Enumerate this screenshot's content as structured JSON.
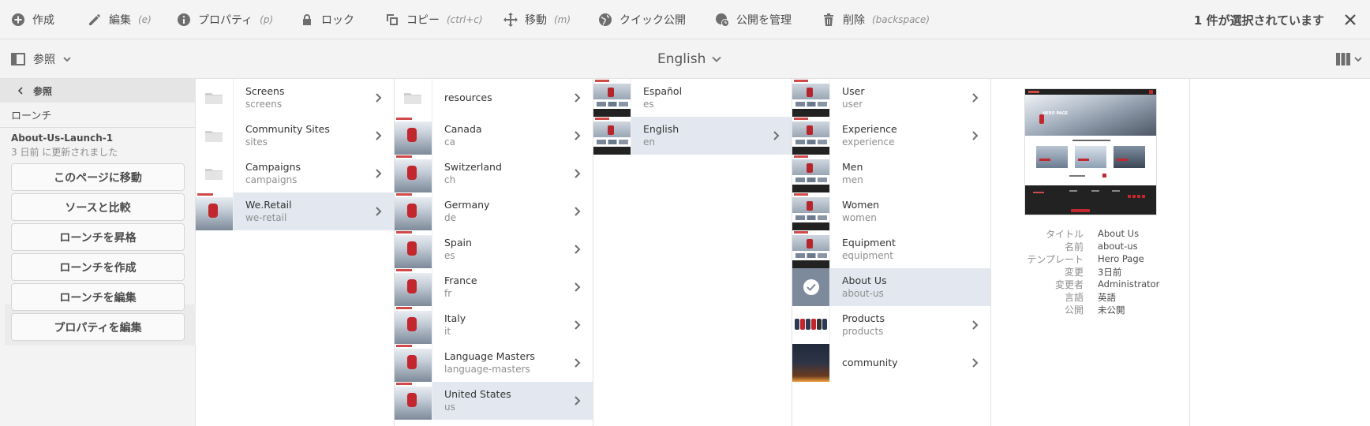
{
  "toolbar": {
    "items": [
      {
        "label": "作成",
        "key": "",
        "icon": "plus-circle-icon"
      },
      {
        "label": "編集",
        "key": "(e)",
        "icon": "pencil-icon"
      },
      {
        "label": "プロパティ",
        "key": "(p)",
        "icon": "info-icon"
      },
      {
        "label": "ロック",
        "key": "",
        "icon": "lock-icon"
      },
      {
        "label": "コピー",
        "key": "(ctrl+c)",
        "icon": "copy-icon"
      },
      {
        "label": "移動",
        "key": "(m)",
        "icon": "move-icon"
      },
      {
        "label": "クイック公開",
        "key": "",
        "icon": "globe-icon"
      },
      {
        "label": "公開を管理",
        "key": "",
        "icon": "globe-clock-icon"
      },
      {
        "label": "削除",
        "key": "(backspace)",
        "icon": "trash-icon"
      }
    ],
    "selection_count": "1 件が選択されています"
  },
  "header": {
    "rail_label": "参照",
    "language": "English"
  },
  "rail": {
    "back_label": "参照",
    "section": "ローンチ",
    "launch_title": "About-Us-Launch-1",
    "launch_updated": "3 日前 に更新されました",
    "buttons": [
      "このページに移動",
      "ソースと比較",
      "ローンチを昇格",
      "ローンチを作成",
      "ローンチを編集",
      "プロパティを編集"
    ]
  },
  "columns": [
    {
      "items": [
        {
          "title": "Screens",
          "name": "screens",
          "thumb": "folder",
          "chevron": true
        },
        {
          "title": "Community Sites",
          "name": "sites",
          "thumb": "folder",
          "chevron": true
        },
        {
          "title": "Campaigns",
          "name": "campaigns",
          "thumb": "folder",
          "chevron": true
        },
        {
          "title": "We.Retail",
          "name": "we-retail",
          "thumb": "red",
          "chevron": true,
          "selected": true
        }
      ]
    },
    {
      "items": [
        {
          "title": "resources",
          "name": "",
          "thumb": "folder",
          "chevron": true
        },
        {
          "title": "Canada",
          "name": "ca",
          "thumb": "red",
          "chevron": true
        },
        {
          "title": "Switzerland",
          "name": "ch",
          "thumb": "red",
          "chevron": true
        },
        {
          "title": "Germany",
          "name": "de",
          "thumb": "red",
          "chevron": true
        },
        {
          "title": "Spain",
          "name": "es",
          "thumb": "red",
          "chevron": true
        },
        {
          "title": "France",
          "name": "fr",
          "thumb": "red",
          "chevron": true
        },
        {
          "title": "Italy",
          "name": "it",
          "thumb": "red",
          "chevron": true
        },
        {
          "title": "Language Masters",
          "name": "language-masters",
          "thumb": "red",
          "chevron": true
        },
        {
          "title": "United States",
          "name": "us",
          "thumb": "red",
          "chevron": true,
          "selected": true
        }
      ]
    },
    {
      "items": [
        {
          "title": "Español",
          "name": "es",
          "thumb": "page",
          "chevron": false
        },
        {
          "title": "English",
          "name": "en",
          "thumb": "page",
          "chevron": true,
          "selected": true
        }
      ]
    },
    {
      "items": [
        {
          "title": "User",
          "name": "user",
          "thumb": "page",
          "chevron": true
        },
        {
          "title": "Experience",
          "name": "experience",
          "thumb": "page",
          "chevron": true
        },
        {
          "title": "Men",
          "name": "men",
          "thumb": "page",
          "chevron": false
        },
        {
          "title": "Women",
          "name": "women",
          "thumb": "page",
          "chevron": false
        },
        {
          "title": "Equipment",
          "name": "equipment",
          "thumb": "page",
          "chevron": false
        },
        {
          "title": "About Us",
          "name": "about-us",
          "thumb": "check",
          "chevron": false,
          "selected": true
        },
        {
          "title": "Products",
          "name": "products",
          "thumb": "products",
          "chevron": true
        },
        {
          "title": "community",
          "name": "",
          "thumb": "night",
          "chevron": true
        }
      ]
    }
  ],
  "preview": {
    "hero_text": "HERO PAGE",
    "meta": [
      {
        "label": "タイトル",
        "value": "About Us"
      },
      {
        "label": "名前",
        "value": "about-us"
      },
      {
        "label": "テンプレート",
        "value": "Hero Page"
      },
      {
        "label": "変更",
        "value": "3日前"
      },
      {
        "label": "変更者",
        "value": "Administrator"
      },
      {
        "label": "言語",
        "value": "英語"
      },
      {
        "label": "公開",
        "value": "未公開"
      }
    ]
  }
}
